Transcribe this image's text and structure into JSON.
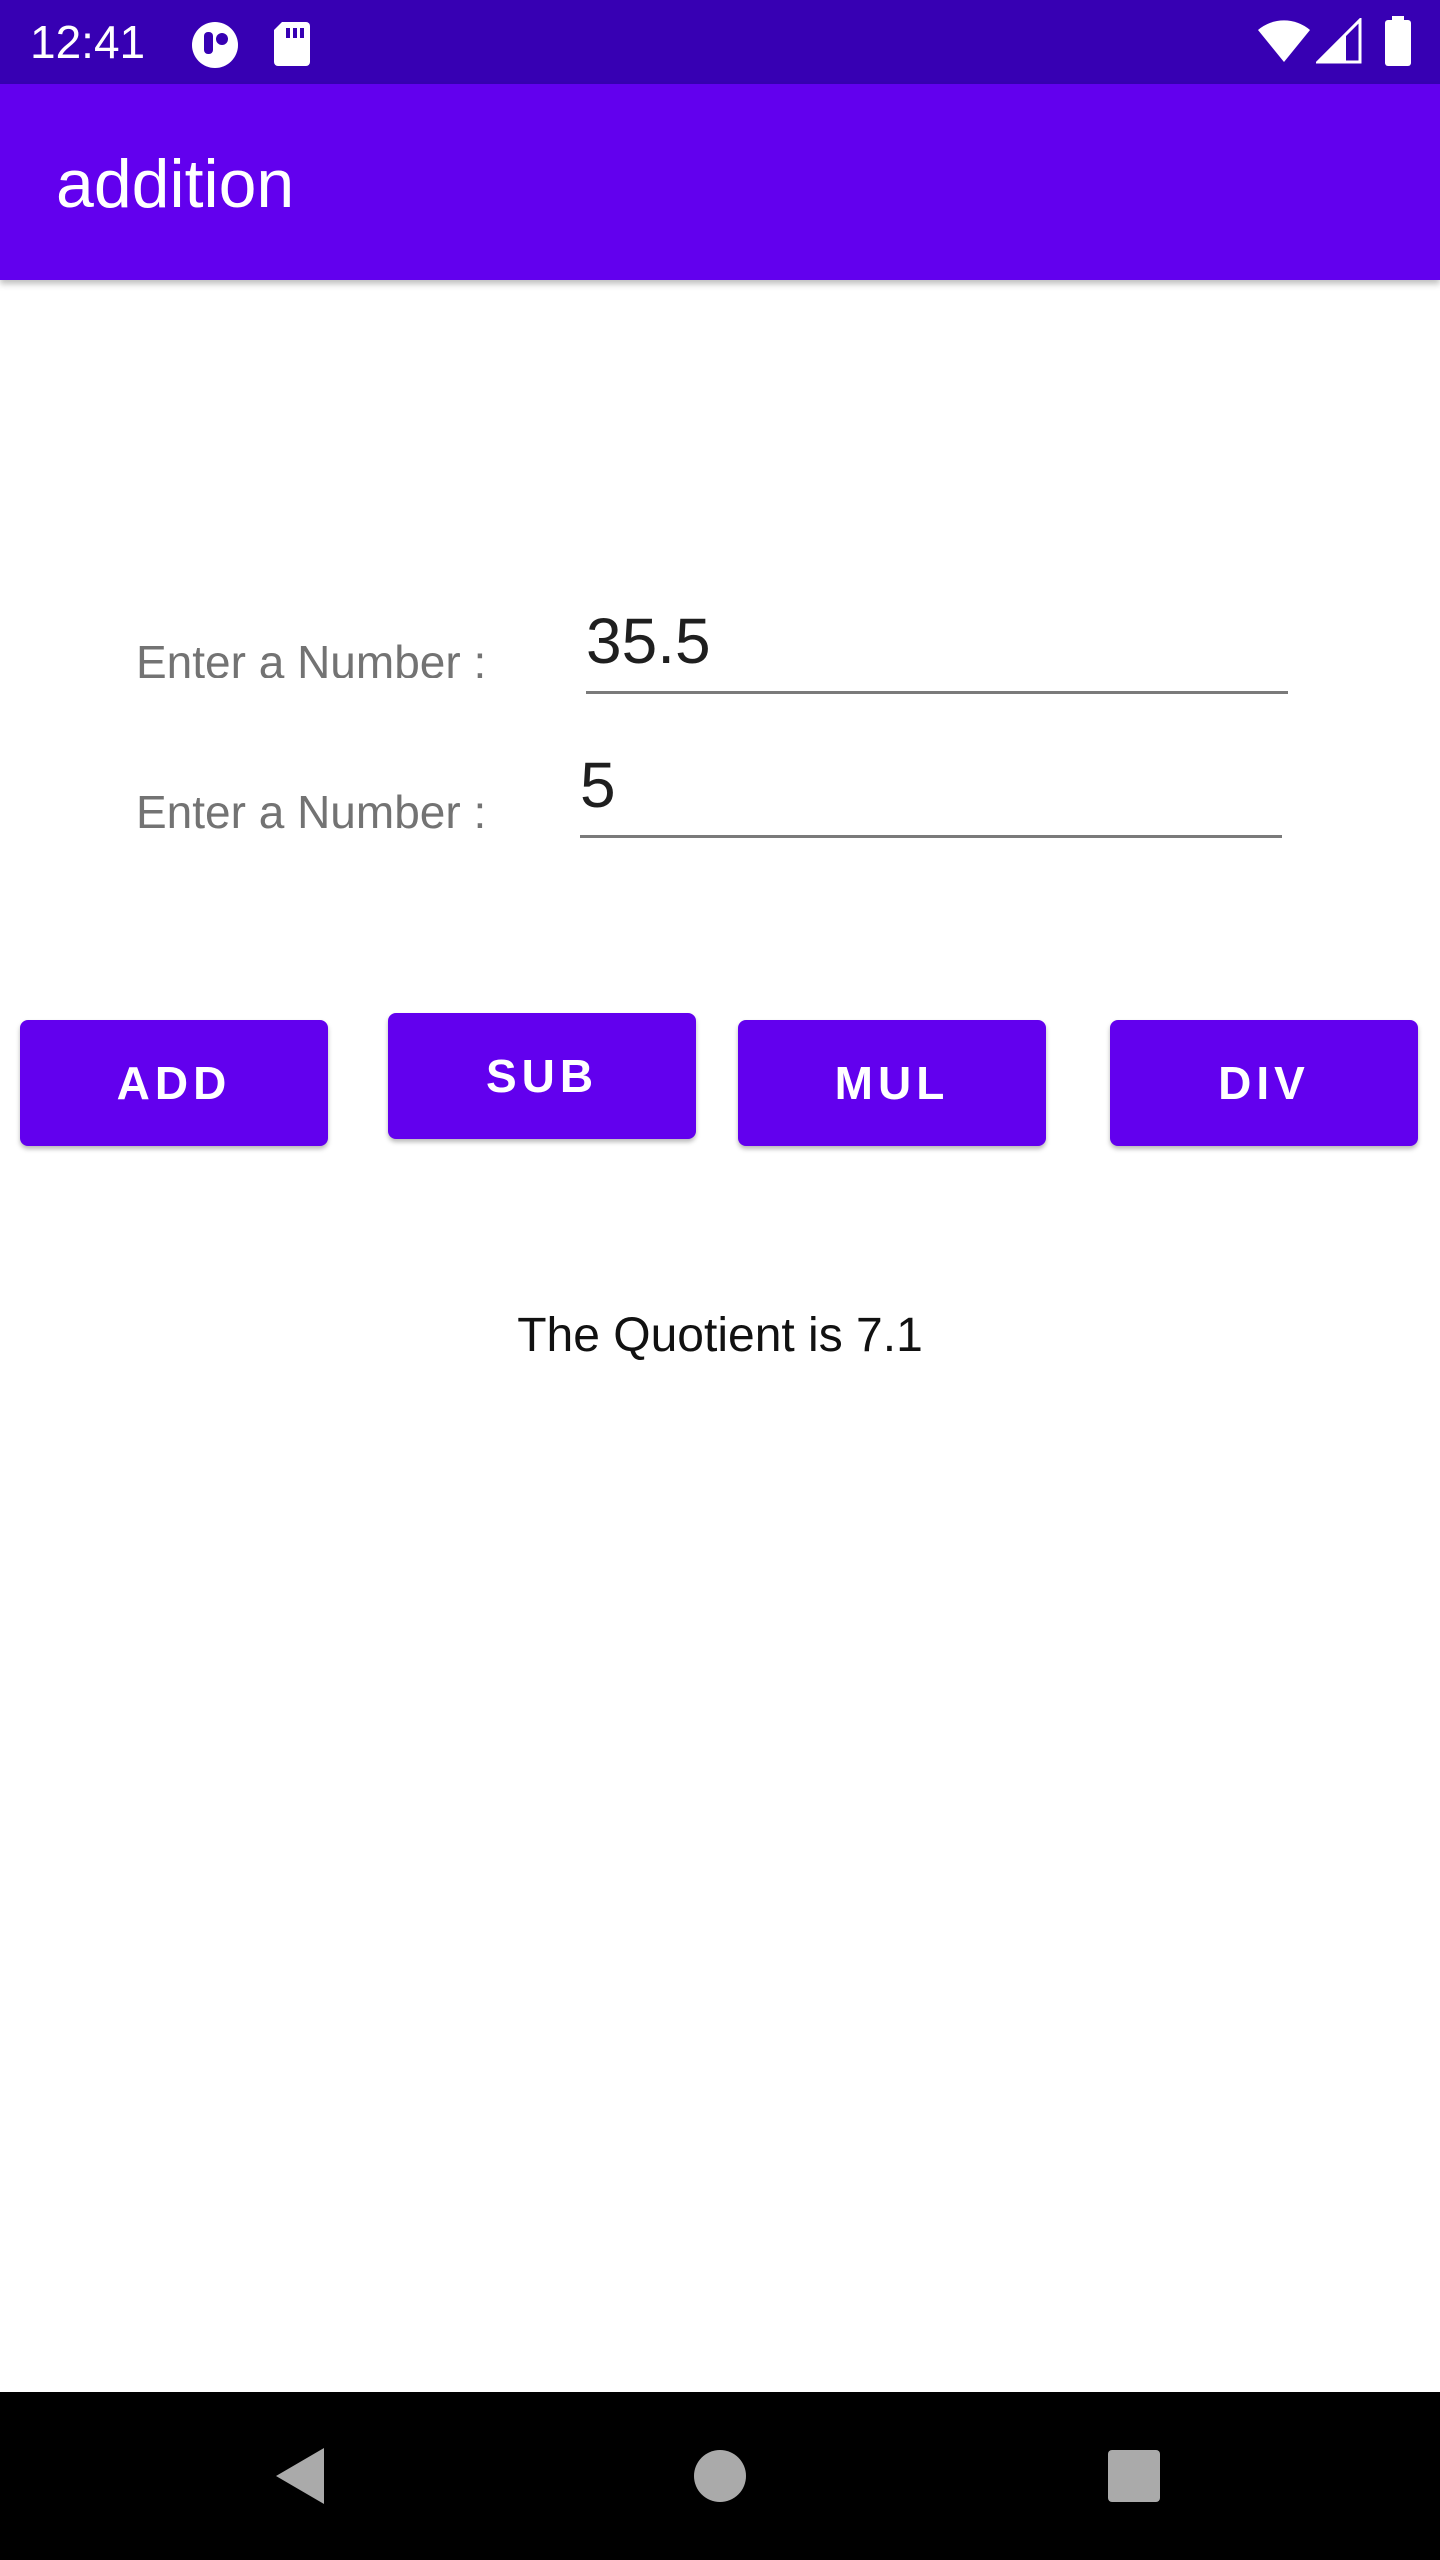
{
  "status_bar": {
    "time": "12:41",
    "icons": [
      "app-notification-icon",
      "sd-card-icon",
      "wifi-icon",
      "cell-signal-icon",
      "battery-icon"
    ]
  },
  "app_bar": {
    "title": "addition"
  },
  "form": {
    "first_label": "Enter a Number :",
    "first_value": "35.5",
    "second_label": "Enter a Number :",
    "second_value": "5"
  },
  "buttons": {
    "add": "ADD",
    "sub": "SUB",
    "mul": "MUL",
    "div": "DIV"
  },
  "result": {
    "text": "The Quotient is 7.1"
  },
  "nav_bar": {
    "icons": [
      "back-icon",
      "home-icon",
      "recent-apps-icon"
    ]
  },
  "colors": {
    "status_bar": "#3700B3",
    "primary": "#6200EE",
    "nav_bar": "#000000"
  }
}
